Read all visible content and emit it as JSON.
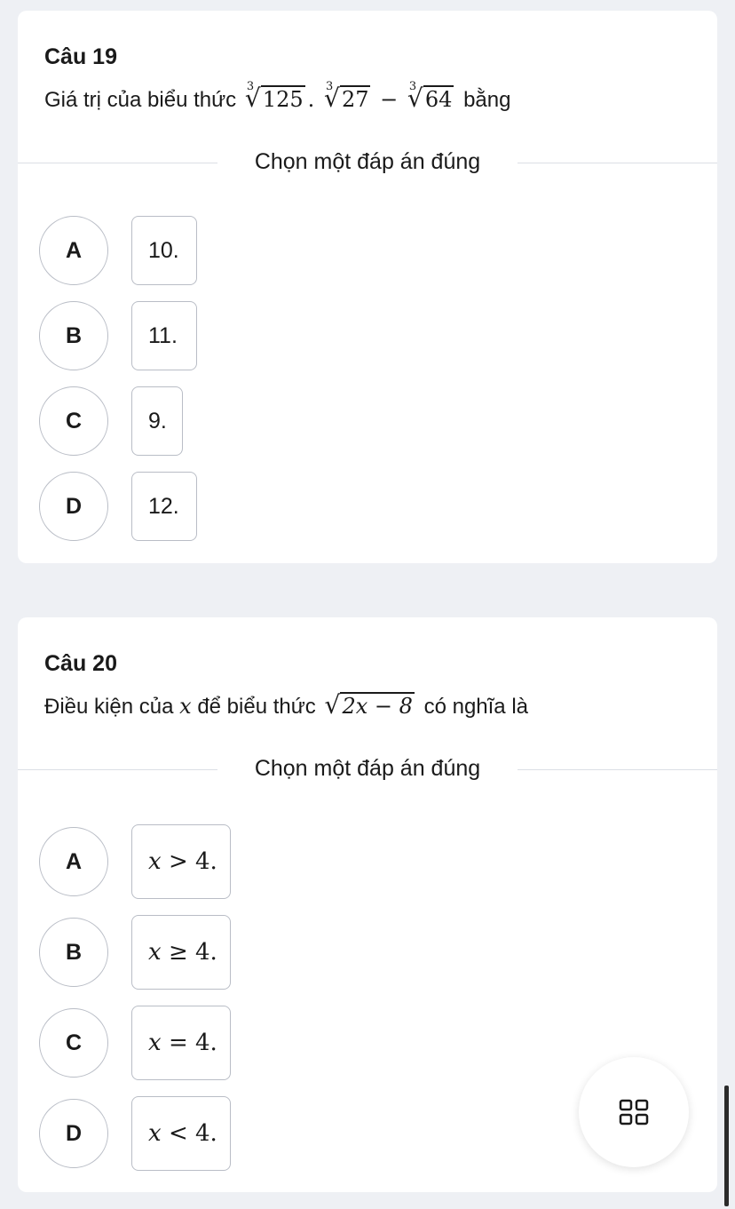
{
  "questions": [
    {
      "title": "Câu 19",
      "prompt_before": "Giá trị của biểu thức",
      "prompt_math": {
        "root1_index": "3",
        "root1_radicand": "125",
        "dot": ".",
        "root2_index": "3",
        "root2_radicand": "27",
        "minus": "−",
        "root3_index": "3",
        "root3_radicand": "64"
      },
      "prompt_after": "bằng",
      "choose_label": "Chọn một đáp án đúng",
      "options": [
        {
          "letter": "A",
          "value": "10."
        },
        {
          "letter": "B",
          "value": "11."
        },
        {
          "letter": "C",
          "value": "9."
        },
        {
          "letter": "D",
          "value": "12."
        }
      ]
    },
    {
      "title": "Câu 20",
      "prompt_before": "Điều kiện của",
      "prompt_var": "x",
      "prompt_middle": "để biểu thức",
      "prompt_radicand": "2x − 8",
      "prompt_after": "có nghĩa là",
      "choose_label": "Chọn một đáp án đúng",
      "options": [
        {
          "letter": "A",
          "var": "x",
          "rel": ">",
          "num": "4."
        },
        {
          "letter": "B",
          "var": "x",
          "rel": "≥",
          "num": "4."
        },
        {
          "letter": "C",
          "var": "x",
          "rel": "=",
          "num": "4."
        },
        {
          "letter": "D",
          "var": "x",
          "rel": "<",
          "num": "4."
        }
      ]
    }
  ],
  "fab_icon": "grid-icon",
  "colors": {
    "background": "#eef0f4",
    "card": "#ffffff",
    "border": "#b9bdc6",
    "text": "#1a1a1a"
  }
}
